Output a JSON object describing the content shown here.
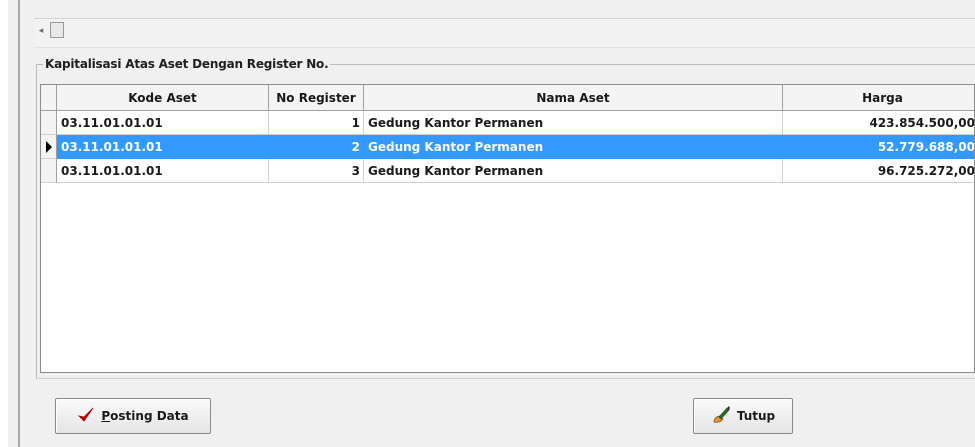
{
  "group": {
    "title": "Kapitalisasi Atas Aset Dengan Register No."
  },
  "grid": {
    "columns": [
      "Kode Aset",
      "No Register",
      "Nama Aset",
      "Harga"
    ],
    "rows": [
      {
        "kode": "03.11.01.01.01",
        "reg": "1",
        "nama": "Gedung Kantor Permanen",
        "harga": "423.854.500,00"
      },
      {
        "kode": "03.11.01.01.01",
        "reg": "2",
        "nama": "Gedung Kantor Permanen",
        "harga": "52.779.688,00"
      },
      {
        "kode": "03.11.01.01.01",
        "reg": "3",
        "nama": "Gedung Kantor Permanen",
        "harga": "96.725.272,00"
      }
    ],
    "selected_row": 1
  },
  "buttons": {
    "posting_label": "Posting Data",
    "posting_mnemonic": "P",
    "posting_rest": "osting Data",
    "tutup_label": "Tutup"
  },
  "icons": {
    "posting": "checkmark-icon",
    "tutup": "hand-pen-icon"
  },
  "colors": {
    "selection": "#3399ff",
    "check": "#cc0000"
  }
}
